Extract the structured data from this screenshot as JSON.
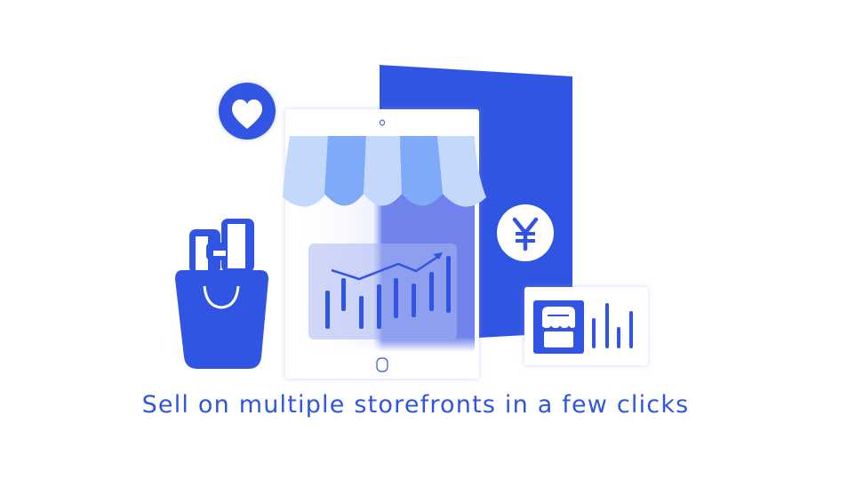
{
  "caption": "Sell on multiple storefronts in a few clicks",
  "colors": {
    "primary": "#3155e3",
    "awning_light": "#c3d8fb",
    "awning_mid": "#7eaaf8",
    "text": "#2f55e4"
  },
  "icons": [
    "heart-icon",
    "yen-icon",
    "shopping-bag-icon",
    "storefront-icon",
    "bar-chart-icon",
    "trend-arrow-icon"
  ]
}
